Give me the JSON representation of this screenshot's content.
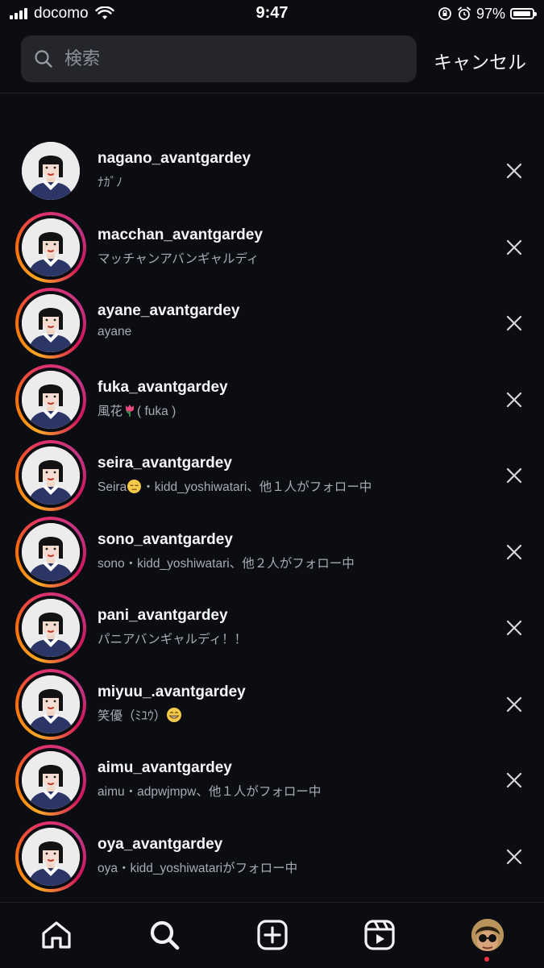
{
  "status_bar": {
    "carrier": "docomo",
    "time": "9:47",
    "battery_percent": "97%",
    "battery_level": 0.97
  },
  "search": {
    "placeholder": "検索",
    "value": "",
    "cancel_label": "キャンセル"
  },
  "results": [
    {
      "username": "nagano_avantgardey",
      "subtitle": "ﾅｶﾞﾉ",
      "story_ring": false
    },
    {
      "username": "macchan_avantgardey",
      "subtitle": "マッチャンアバンギャルディ",
      "story_ring": true
    },
    {
      "username": "ayane_avantgardey",
      "subtitle": "ayane",
      "story_ring": true
    },
    {
      "username": "fuka_avantgardey",
      "subtitle": "風花",
      "subtitle_suffix": "( fuka )",
      "emoji": "tulip-emoji",
      "story_ring": true
    },
    {
      "username": "seira_avantgardey",
      "subtitle": "Seira",
      "subtitle_suffix": "・kidd_yoshiwatari、他１人がフォロー中",
      "emoji": "pensive-face-emoji",
      "story_ring": true
    },
    {
      "username": "sono_avantgardey",
      "subtitle": "sono・kidd_yoshiwatari、他２人がフォロー中",
      "story_ring": true
    },
    {
      "username": "pani_avantgardey",
      "subtitle": "パニアバンギャルディ！！",
      "story_ring": true
    },
    {
      "username": "miyuu_.avantgardey",
      "subtitle": "笑優（ﾐﾕｳ）",
      "emoji": "grinning-face-emoji",
      "story_ring": true
    },
    {
      "username": "aimu_avantgardey",
      "subtitle": "aimu・adpwjmpw、他１人がフォロー中",
      "story_ring": true
    },
    {
      "username": "oya_avantgardey",
      "subtitle": "oya・kidd_yoshiwatariがフォロー中",
      "story_ring": true
    }
  ],
  "tab_bar": {
    "items": [
      "home-icon",
      "search-icon",
      "create-icon",
      "reels-icon",
      "profile-avatar"
    ],
    "notification_dot_color": "#ff3040"
  },
  "colors": {
    "background": "#0b0d12",
    "search_field": "#24262b",
    "secondary_text": "#a8abb2"
  }
}
